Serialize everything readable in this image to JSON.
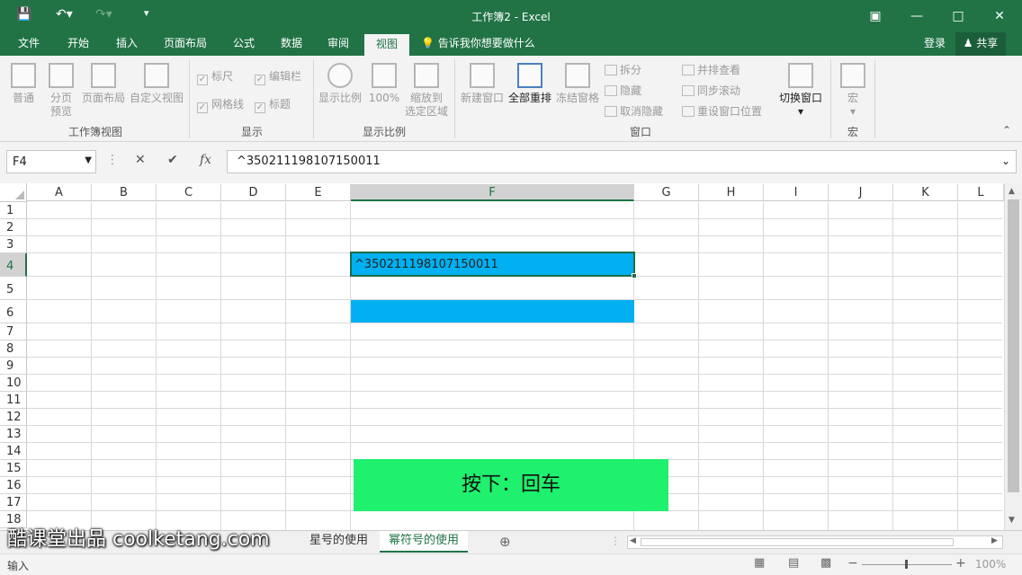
{
  "window": {
    "title": "工作簿2 - Excel"
  },
  "menu": {
    "tabs": [
      "文件",
      "开始",
      "插入",
      "页面布局",
      "公式",
      "数据",
      "审阅",
      "视图"
    ],
    "active_tab": "视图",
    "tell_me": "告诉我你想要做什么",
    "login": "登录",
    "share": "共享"
  },
  "ribbon": {
    "workbook_views": {
      "label": "工作簿视图",
      "normal": "普通",
      "page_break_1": "分页",
      "page_break_2": "预览",
      "page_layout": "页面布局",
      "custom_views": "自定义视图"
    },
    "show": {
      "label": "显示",
      "ruler": "标尺",
      "formula_bar": "编辑栏",
      "gridlines": "网格线",
      "headings": "标题"
    },
    "zoom": {
      "label": "显示比例",
      "zoom": "显示比例",
      "hundred": "100%",
      "to_selection_1": "缩放到",
      "to_selection_2": "选定区域"
    },
    "window": {
      "label": "窗口",
      "new_window": "新建窗口",
      "arrange_all": "全部重排",
      "freeze_panes": "冻结窗格",
      "split": "拆分",
      "hide": "隐藏",
      "unhide": "取消隐藏",
      "side_by_side": "并排查看",
      "sync_scroll": "同步滚动",
      "reset_position": "重设窗口位置",
      "switch_windows": "切换窗口"
    },
    "macros": {
      "label": "宏",
      "macros": "宏"
    }
  },
  "formula_bar": {
    "name_box": "F4",
    "cancel": "✕",
    "enter": "✔",
    "fx": "fx",
    "content": "^350211198107150011"
  },
  "grid": {
    "columns": [
      "A",
      "B",
      "C",
      "D",
      "E",
      "F",
      "G",
      "H",
      "I",
      "J",
      "K",
      "L"
    ],
    "rows": [
      "1",
      "2",
      "3",
      "4",
      "5",
      "6",
      "7",
      "8",
      "9",
      "10",
      "11",
      "12",
      "13",
      "14",
      "15",
      "16",
      "17",
      "18"
    ],
    "selected_column": "F",
    "selected_row": "4",
    "cell_F4": "^350211198107150011",
    "highlight_color": "#00b0f0"
  },
  "hint": {
    "text": "按下：回车",
    "color": "#1ff06e"
  },
  "sheets": {
    "tabs": [
      "星号的使用",
      "幂符号的使用"
    ],
    "active": "幂符号的使用"
  },
  "watermark": "酷课堂出品 coolketang.com",
  "status": {
    "mode": "输入",
    "zoom": "100%"
  }
}
